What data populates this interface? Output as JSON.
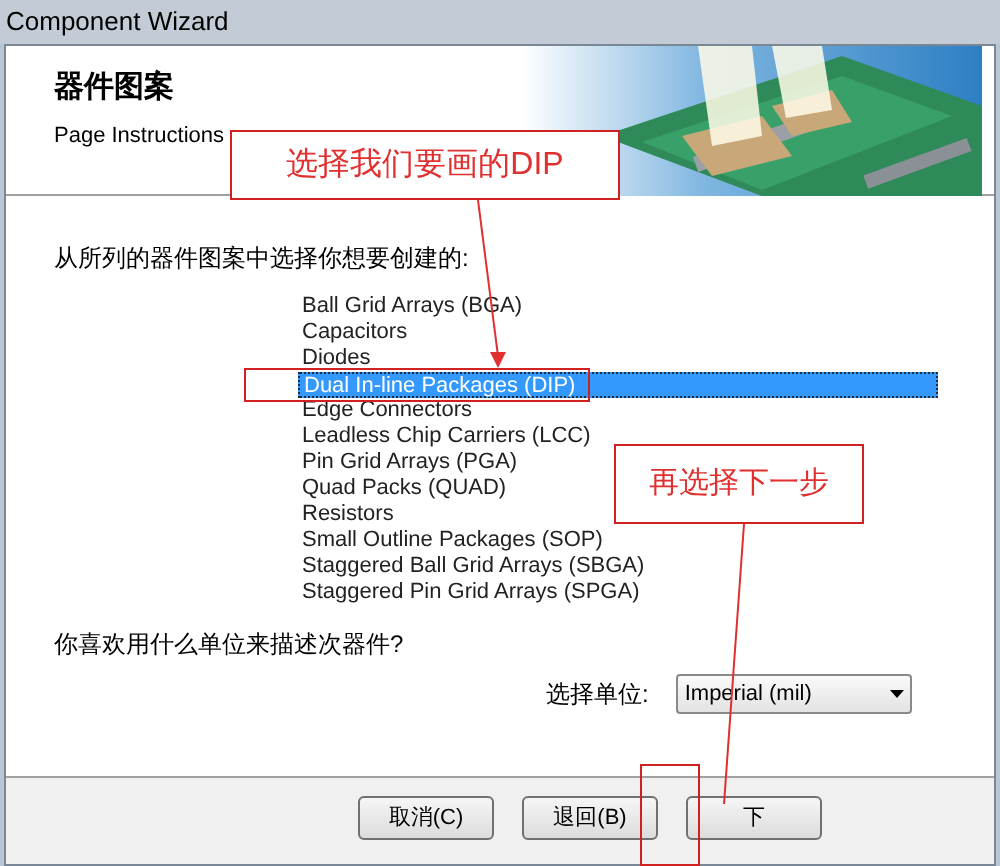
{
  "window": {
    "title": "Component Wizard"
  },
  "header": {
    "title": "器件图案",
    "subtitle": "Page Instructions"
  },
  "instruction": "从所列的器件图案中选择你想要创建的:",
  "patterns": [
    {
      "label": "Ball Grid Arrays (BGA)",
      "selected": false
    },
    {
      "label": "Capacitors",
      "selected": false
    },
    {
      "label": "Diodes",
      "selected": false
    },
    {
      "label": "Dual In-line Packages (DIP)",
      "selected": true
    },
    {
      "label": "Edge Connectors",
      "selected": false
    },
    {
      "label": "Leadless Chip Carriers (LCC)",
      "selected": false
    },
    {
      "label": "Pin Grid Arrays (PGA)",
      "selected": false
    },
    {
      "label": "Quad Packs (QUAD)",
      "selected": false
    },
    {
      "label": "Resistors",
      "selected": false
    },
    {
      "label": "Small Outline Packages (SOP)",
      "selected": false
    },
    {
      "label": "Staggered Ball Grid Arrays (SBGA)",
      "selected": false
    },
    {
      "label": "Staggered Pin Grid Arrays (SPGA)",
      "selected": false
    }
  ],
  "question": "你喜欢用什么单位来描述次器件?",
  "units": {
    "label": "选择单位:",
    "value": "Imperial (mil)"
  },
  "buttons": [
    "取消(C)",
    "退回(B)",
    "下"
  ],
  "annotations": [
    {
      "text": "选择我们要画的DIP"
    },
    {
      "text": "再选择下一步"
    }
  ]
}
